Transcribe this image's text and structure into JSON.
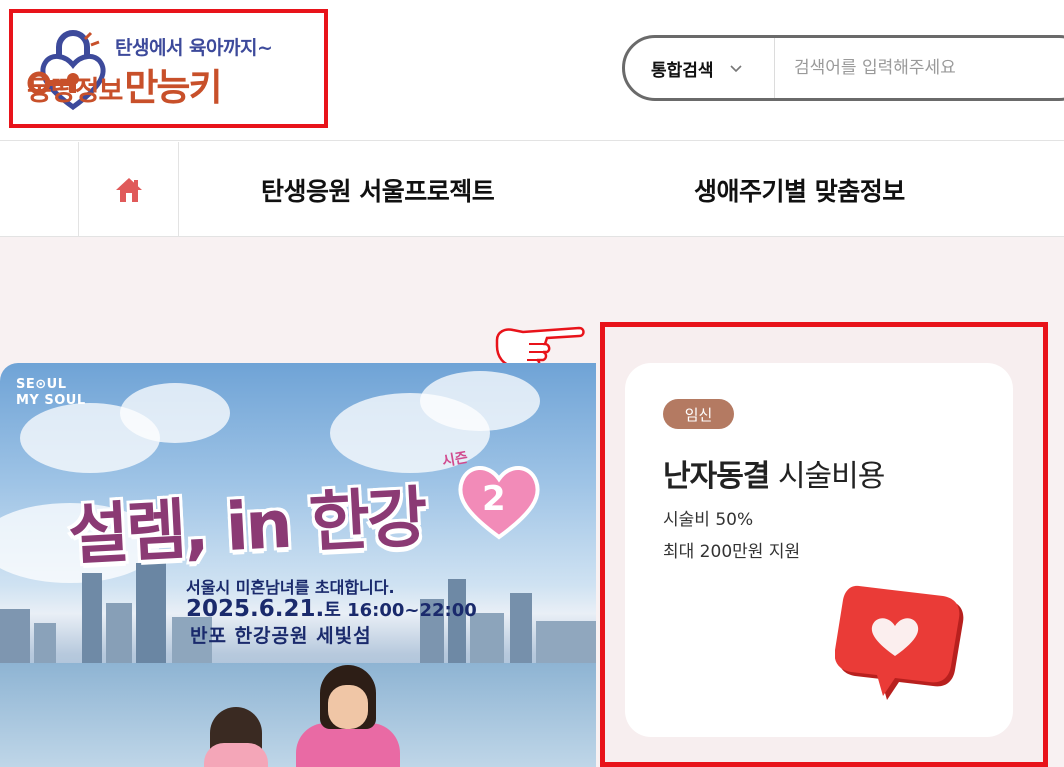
{
  "logo": {
    "line1": "탄생에서 육아까지~",
    "line2_a": "몽땅정보",
    "line2_b": "만능키"
  },
  "search": {
    "scope_label": "통합검색",
    "placeholder": "검색어를 입력해주세요"
  },
  "nav": {
    "home_icon": "home-icon",
    "items": [
      {
        "label": "탄생응원 서울프로젝트"
      },
      {
        "label": "생애주기별 맞춤정보"
      }
    ]
  },
  "banner": {
    "brand": "SEOUL MY SOUL",
    "brand_line1": "SE⊙UL",
    "brand_line2": "MY SOUL",
    "title": "설렘, in 한강",
    "season_label": "시즌",
    "season_number": "2",
    "line1": "서울시 미혼남녀를 초대합니다.",
    "line2_date": "2025.6.21.",
    "line2_rest": "토 16:00~22:00",
    "line3": "반포 한강공원 세빛섬"
  },
  "card": {
    "tag": "임신",
    "title_bold": "난자동결",
    "title_rest": " 시술비용",
    "desc1": "시술비 50%",
    "desc2": "최대 200만원 지원",
    "icon": "heart-bubble-icon"
  },
  "colors": {
    "highlight_border": "#e8131a",
    "tag_bg": "#b47a62",
    "page_bg": "#f8f1f2",
    "logo_orange": "#c8502a",
    "logo_blue": "#3d4a9b"
  }
}
